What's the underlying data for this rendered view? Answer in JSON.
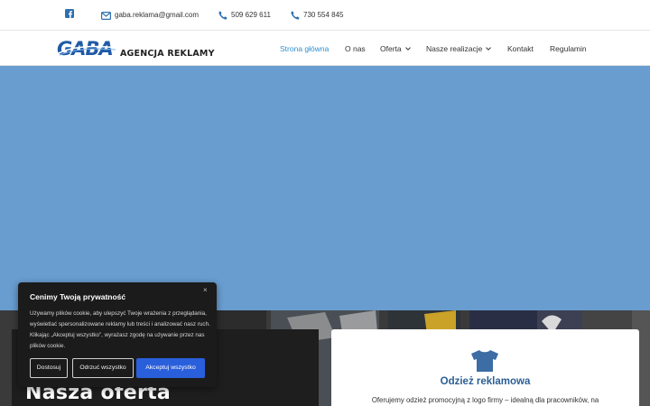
{
  "topbar": {
    "facebook_icon": "facebook-icon",
    "email": "gaba.reklama@gmail.com",
    "phone1": "509 629 611",
    "phone2": "730 554 845",
    "icon_color": "#2f6fb0"
  },
  "header": {
    "logo_word": "GABA",
    "logo_text": "AGENCJA REKLAMY",
    "nav": [
      {
        "label": "Strona główna",
        "active": true
      },
      {
        "label": "O nas"
      },
      {
        "label": "Oferta",
        "has_dropdown": true
      },
      {
        "label": "Nasze realizacje",
        "has_dropdown": true
      },
      {
        "label": "Kontakt"
      },
      {
        "label": "Regulamin"
      }
    ],
    "active_color": "#2f8fcf"
  },
  "hero": {
    "background": "#699dd0"
  },
  "offer": {
    "title": "Nasza oferta",
    "card": {
      "icon": "tshirt-icon",
      "title": "Odzież reklamowa",
      "text": "Oferujemy odzież promocyjną z logo firmy – idealną dla pracowników, na"
    }
  },
  "cookie": {
    "title": "Cenimy Twoją prywatność",
    "body": "Używamy plików cookie, aby ulepszyć Twoje wrażenia z przeglądania, wyświetlać spersonalizowane reklamy lub treści i analizować nasz ruch. Klikając „Akceptuj wszystko”, wyrażasz zgodę na używanie przez nas plików cookie.",
    "close": "×",
    "buttons": {
      "customize": "Dostosuj",
      "reject": "Odrzuć wszystko",
      "accept": "Akceptuj wszystko"
    },
    "accept_color": "#2a5fdb"
  }
}
